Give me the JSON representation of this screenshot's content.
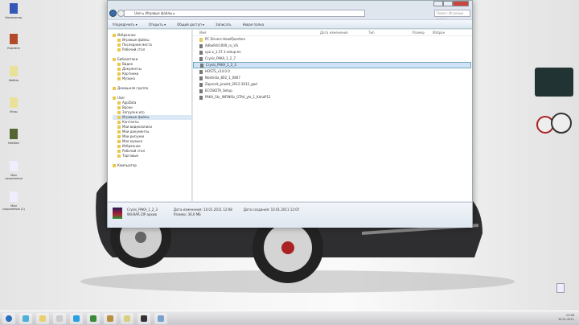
{
  "desktop": {
    "icons": [
      "Компьютер",
      "Корзина",
      "Файлы",
      "Игры",
      "NetWall",
      "Мои сохранения",
      "Мои сохранения (2)"
    ]
  },
  "window": {
    "address": [
      "User",
      "Игровые файлы"
    ],
    "search_placeholder": "Поиск: Игровые файлы",
    "toolbar": [
      "Упорядочить ▾",
      "Открыть ▾",
      "Общий доступ ▾",
      "Записать",
      "Новая папка"
    ],
    "nav": {
      "favorites": {
        "label": "Избранное",
        "items": [
          "Игровые файлы",
          "Последние места",
          "Рабочий стол"
        ]
      },
      "libraries": {
        "label": "Библиотеки",
        "items": [
          "Видео",
          "Документы",
          "Картинки",
          "Музыка"
        ]
      },
      "homegroup": "Домашняя группа",
      "user": {
        "label": "User",
        "items": [
          "AppData",
          "Вроки",
          "Загрузки игр",
          "Игровые файлы",
          "Контакты",
          "Мои видеозаписи",
          "Мои документы",
          "Мои рисунки",
          "Моя музыка",
          "Избранное",
          "Рабочий стол",
          "Торговые"
        ],
        "selected": 3
      },
      "computer": "Компьютер"
    },
    "columns": [
      "Имя",
      "Дата изменения",
      "Тип",
      "Размер",
      "Избран"
    ],
    "files": [
      "PC Drivers HeadQuarters",
      "AdbeRdr1000_ru_US",
      "cpu-z_1.57.1-setup-en",
      "Crysis_PAKA_1_2_7",
      "Crysis_PAKA_1_2_3",
      "HOSTS_v14.0.0",
      "Nokhidia_802_1_0807",
      "Zaprosit_proekt_2012-2012_god",
      "ECOSIDTA_Setup",
      "PAKA_Skr_INFINISs_GTA4_yts_1_KahaP12"
    ],
    "selected_file": 4,
    "details": {
      "name": "Crysis_PAKA_1_2_3",
      "type": "WinRAR ZIP архив",
      "modified": "Дата изменения: 10.01.2011 12:08",
      "size": "Размер: 36,0 МБ",
      "created": "Дата создания: 10.01.2011 12:07"
    }
  },
  "taskbar": {
    "time": "12:08",
    "date": "10.01.2011"
  }
}
